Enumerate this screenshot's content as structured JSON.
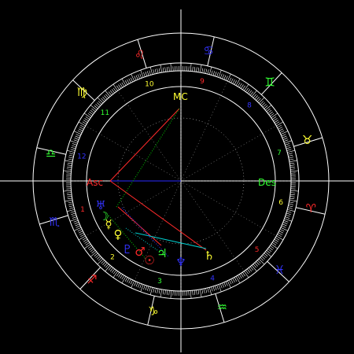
{
  "colors": {
    "background": "#000000",
    "ring": "#ffffff",
    "fire": "#ff2a2a",
    "earth": "#ffff33",
    "air": "#33ff33",
    "water": "#3333ff",
    "aspect_square": "#ff2a2a",
    "aspect_trine": "#2a2aff",
    "aspect_sextile": "#00cc00",
    "aspect_quintile": "#00cccc",
    "cusp_line": "#bfbfbf"
  },
  "zodiac": [
    {
      "sign": "aries",
      "glyph": "♈",
      "element": "fire"
    },
    {
      "sign": "taurus",
      "glyph": "♉",
      "element": "earth"
    },
    {
      "sign": "gemini",
      "glyph": "♊",
      "element": "air"
    },
    {
      "sign": "cancer",
      "glyph": "♋",
      "element": "water"
    },
    {
      "sign": "leo",
      "glyph": "♌",
      "element": "fire"
    },
    {
      "sign": "virgo",
      "glyph": "♍",
      "element": "earth"
    },
    {
      "sign": "libra",
      "glyph": "♎",
      "element": "air"
    },
    {
      "sign": "scorpio",
      "glyph": "♏",
      "element": "water"
    },
    {
      "sign": "sagittarius",
      "glyph": "♐",
      "element": "fire"
    },
    {
      "sign": "capricorn",
      "glyph": "♑",
      "element": "earth"
    },
    {
      "sign": "aquarius",
      "glyph": "♒",
      "element": "air"
    },
    {
      "sign": "pisces",
      "glyph": "♓",
      "element": "water"
    }
  ],
  "houses": [
    {
      "num": "1",
      "color": "#ff2a2a"
    },
    {
      "num": "2",
      "color": "#ffff33"
    },
    {
      "num": "3",
      "color": "#33ff33"
    },
    {
      "num": "4",
      "color": "#3333ff"
    },
    {
      "num": "5",
      "color": "#ff2a2a"
    },
    {
      "num": "6",
      "color": "#ffff33"
    },
    {
      "num": "7",
      "color": "#33ff33"
    },
    {
      "num": "8",
      "color": "#3333ff"
    },
    {
      "num": "9",
      "color": "#ff2a2a"
    },
    {
      "num": "10",
      "color": "#ffff33"
    },
    {
      "num": "11",
      "color": "#33ff33"
    },
    {
      "num": "12",
      "color": "#3333ff"
    }
  ],
  "angles": {
    "asc": {
      "label": "Asc",
      "color": "#ff2a2a"
    },
    "mc": {
      "label": "MC",
      "color": "#ffff33"
    },
    "des": {
      "label": "Des",
      "color": "#33ff33"
    }
  },
  "planets": [
    {
      "name": "uranus",
      "glyph": "♅",
      "color": "#3333ff"
    },
    {
      "name": "moon",
      "glyph": "☽",
      "color": "#33ff33"
    },
    {
      "name": "mercury",
      "glyph": "☿",
      "color": "#ffff33"
    },
    {
      "name": "venus",
      "glyph": "♀",
      "color": "#ffff33"
    },
    {
      "name": "pluto",
      "glyph": "♇",
      "color": "#3333ff"
    },
    {
      "name": "mars",
      "glyph": "♂",
      "color": "#ff2a2a"
    },
    {
      "name": "jupiter",
      "glyph": "♃",
      "color": "#33ff33"
    },
    {
      "name": "neptune",
      "glyph": "♆",
      "color": "#3333ff"
    },
    {
      "name": "saturn",
      "glyph": "♄",
      "color": "#ffff33"
    },
    {
      "name": "sun",
      "glyph": "☉",
      "color": "#ff2a2a"
    }
  ]
}
